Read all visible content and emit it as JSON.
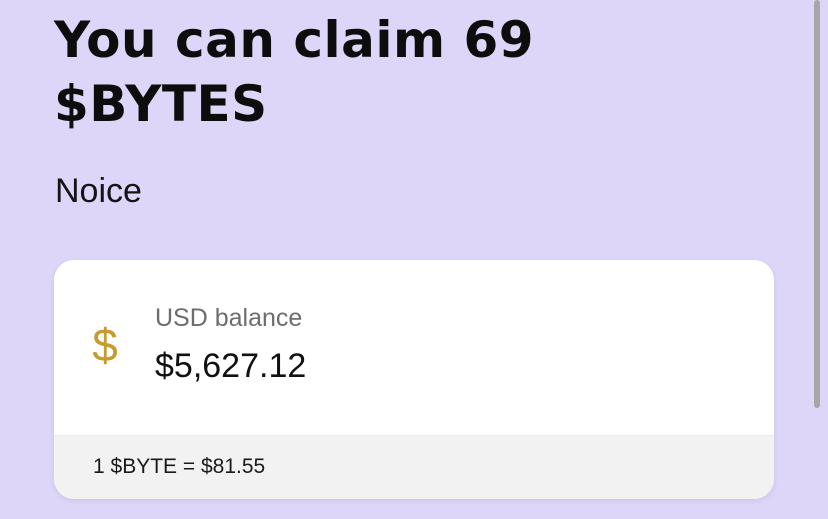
{
  "title": "You can claim 69 $BYTES",
  "subtitle": "Noice",
  "balance_card": {
    "icon": "dollar-icon",
    "label": "USD balance",
    "value": "$5,627.12",
    "rate": "1 $BYTE = $81.55"
  },
  "colors": {
    "page_background": "#ddd6f8",
    "card_background": "#ffffff",
    "footer_background": "#f2f2f2",
    "icon_color": "#c89b2d",
    "text_primary": "#111111",
    "text_secondary": "#6d6d6d"
  },
  "icons": {
    "currency": "$"
  }
}
